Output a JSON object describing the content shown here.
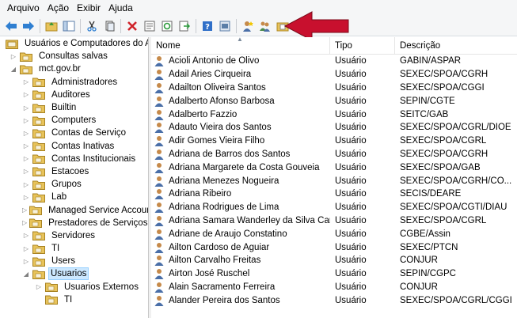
{
  "menu": [
    "Arquivo",
    "Ação",
    "Exibir",
    "Ajuda"
  ],
  "toolbar_icons": [
    "back-arrow-icon",
    "forward-arrow-icon",
    "up-folder-icon",
    "show-hide-console-tree-icon",
    "cut-icon",
    "copy-icon",
    "delete-icon",
    "properties-icon",
    "refresh-icon",
    "export-list-icon",
    "help-icon",
    "console-icon",
    "new-user-icon",
    "new-group-icon",
    "new-ou-icon",
    "filter-icon",
    "add-to-group-icon"
  ],
  "tree": {
    "root": "Usuários e Computadores do Active D",
    "items": [
      {
        "label": "Consultas salvas",
        "level": 1,
        "expander": "▷"
      },
      {
        "label": "mct.gov.br",
        "level": 1,
        "expander": "◢"
      },
      {
        "label": "Administradores",
        "level": 2,
        "expander": "▷"
      },
      {
        "label": "Auditores",
        "level": 2,
        "expander": "▷"
      },
      {
        "label": "Builtin",
        "level": 2,
        "expander": "▷"
      },
      {
        "label": "Computers",
        "level": 2,
        "expander": "▷"
      },
      {
        "label": "Contas de Serviço",
        "level": 2,
        "expander": "▷"
      },
      {
        "label": "Contas Inativas",
        "level": 2,
        "expander": "▷"
      },
      {
        "label": "Contas Institucionais",
        "level": 2,
        "expander": "▷"
      },
      {
        "label": "Estacoes",
        "level": 2,
        "expander": "▷"
      },
      {
        "label": "Grupos",
        "level": 2,
        "expander": "▷"
      },
      {
        "label": "Lab",
        "level": 2,
        "expander": "▷"
      },
      {
        "label": "Managed Service Accounts",
        "level": 2,
        "expander": "▷"
      },
      {
        "label": "Prestadores de Serviços",
        "level": 2,
        "expander": "▷"
      },
      {
        "label": "Servidores",
        "level": 2,
        "expander": "▷"
      },
      {
        "label": "TI",
        "level": 2,
        "expander": "▷"
      },
      {
        "label": "Users",
        "level": 2,
        "expander": "▷"
      },
      {
        "label": "Usuarios",
        "level": 2,
        "expander": "◢",
        "selected": true
      },
      {
        "label": "Usuarios Externos",
        "level": 3,
        "expander": "▷"
      },
      {
        "label": "TI",
        "level": 3,
        "expander": ""
      }
    ]
  },
  "list": {
    "headers": {
      "name": "Nome",
      "tipo": "Tipo",
      "desc": "Descrição"
    },
    "rows": [
      {
        "name": "Acioli Antonio de Olivo",
        "tipo": "Usuário",
        "desc": "GABIN/ASPAR"
      },
      {
        "name": "Adail Aries Cirqueira",
        "tipo": "Usuário",
        "desc": "SEXEC/SPOA/CGRH"
      },
      {
        "name": "Adailton Oliveira  Santos",
        "tipo": "Usuário",
        "desc": "SEXEC/SPOA/CGGI"
      },
      {
        "name": "Adalberto Afonso Barbosa",
        "tipo": "Usuário",
        "desc": "SEPIN/CGTE"
      },
      {
        "name": "Adalberto Fazzio",
        "tipo": "Usuário",
        "desc": "SEITC/GAB"
      },
      {
        "name": "Adauto Vieira dos Santos",
        "tipo": "Usuário",
        "desc": "SEXEC/SPOA/CGRL/DIOE"
      },
      {
        "name": "Adir Gomes Vieira Filho",
        "tipo": "Usuário",
        "desc": "SEXEC/SPOA/CGRL"
      },
      {
        "name": "Adriana de Barros dos Santos",
        "tipo": "Usuário",
        "desc": "SEXEC/SPOA/CGRH"
      },
      {
        "name": "Adriana Margarete da Costa Gouveia",
        "tipo": "Usuário",
        "desc": "SEXEC/SPOA/GAB"
      },
      {
        "name": "Adriana Menezes Nogueira",
        "tipo": "Usuário",
        "desc": "SEXEC/SPOA/CGRH/CO..."
      },
      {
        "name": "Adriana Ribeiro",
        "tipo": "Usuário",
        "desc": "SECIS/DEARE"
      },
      {
        "name": "Adriana Rodrigues de Lima",
        "tipo": "Usuário",
        "desc": "SEXEC/SPOA/CGTI/DIAU"
      },
      {
        "name": "Adriana Samara Wanderley da Silva Carvalho",
        "tipo": "Usuário",
        "desc": "SEXEC/SPOA/CGRL"
      },
      {
        "name": "Adriane de Araujo Constatino",
        "tipo": "Usuário",
        "desc": "CGBE/Assin"
      },
      {
        "name": "Ailton Cardoso de Aguiar",
        "tipo": "Usuário",
        "desc": "SEXEC/PTCN"
      },
      {
        "name": "Ailton Carvalho Freitas",
        "tipo": "Usuário",
        "desc": "CONJUR"
      },
      {
        "name": "Airton José Ruschel",
        "tipo": "Usuário",
        "desc": "SEPIN/CGPC"
      },
      {
        "name": "Alain Sacramento Ferreira",
        "tipo": "Usuário",
        "desc": "CONJUR"
      },
      {
        "name": "Alander Pereira dos Santos",
        "tipo": "Usuário",
        "desc": "SEXEC/SPOA/CGRL/CGGI"
      }
    ]
  },
  "colors": {
    "arrow": "#c8102e",
    "selection": "#cce8ff",
    "folder": "#e8c35a"
  }
}
